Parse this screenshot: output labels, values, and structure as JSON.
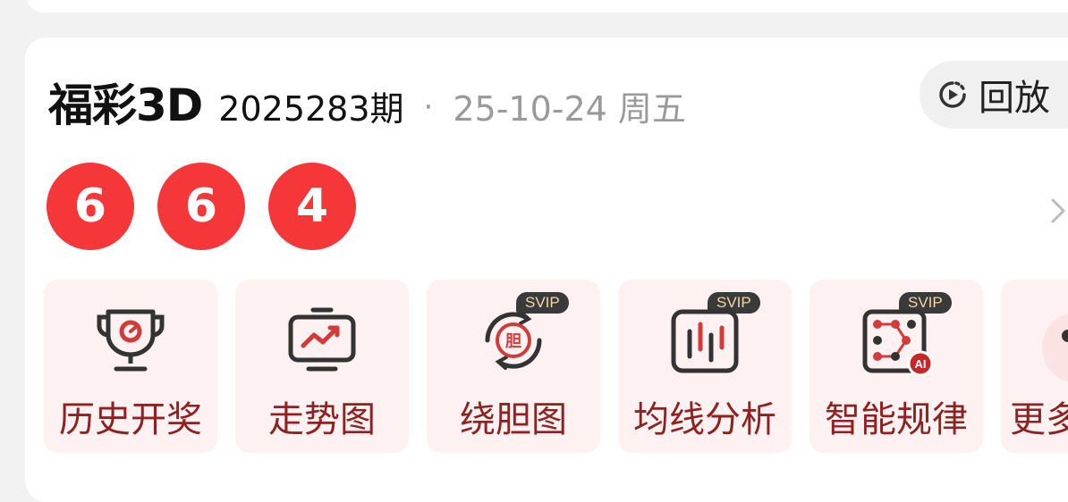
{
  "header": {
    "game_name": "福彩3D",
    "issue": "2025283期",
    "separator": "·",
    "date": "25-10-24 周五",
    "replay_label": "回放"
  },
  "draw": {
    "numbers": [
      "6",
      "6",
      "4"
    ],
    "ball_color": "#f5373a"
  },
  "tools": [
    {
      "label": "历史开奖",
      "icon": "trophy-icon",
      "badge": ""
    },
    {
      "label": "走势图",
      "icon": "trend-chart-icon",
      "badge": ""
    },
    {
      "label": "绕胆图",
      "icon": "dan-cycle-icon",
      "badge": "SVIP",
      "icon_text": "胆"
    },
    {
      "label": "均线分析",
      "icon": "candlestick-icon",
      "badge": "SVIP"
    },
    {
      "label": "智能规律",
      "icon": "ai-pattern-icon",
      "badge": "SVIP",
      "icon_text": "AI"
    },
    {
      "label": "更多",
      "icon": "more-icon",
      "badge": ""
    }
  ],
  "colors": {
    "accent": "#f5373a",
    "tool_label": "#8e2222",
    "tool_bg": "#fdf1f1"
  }
}
